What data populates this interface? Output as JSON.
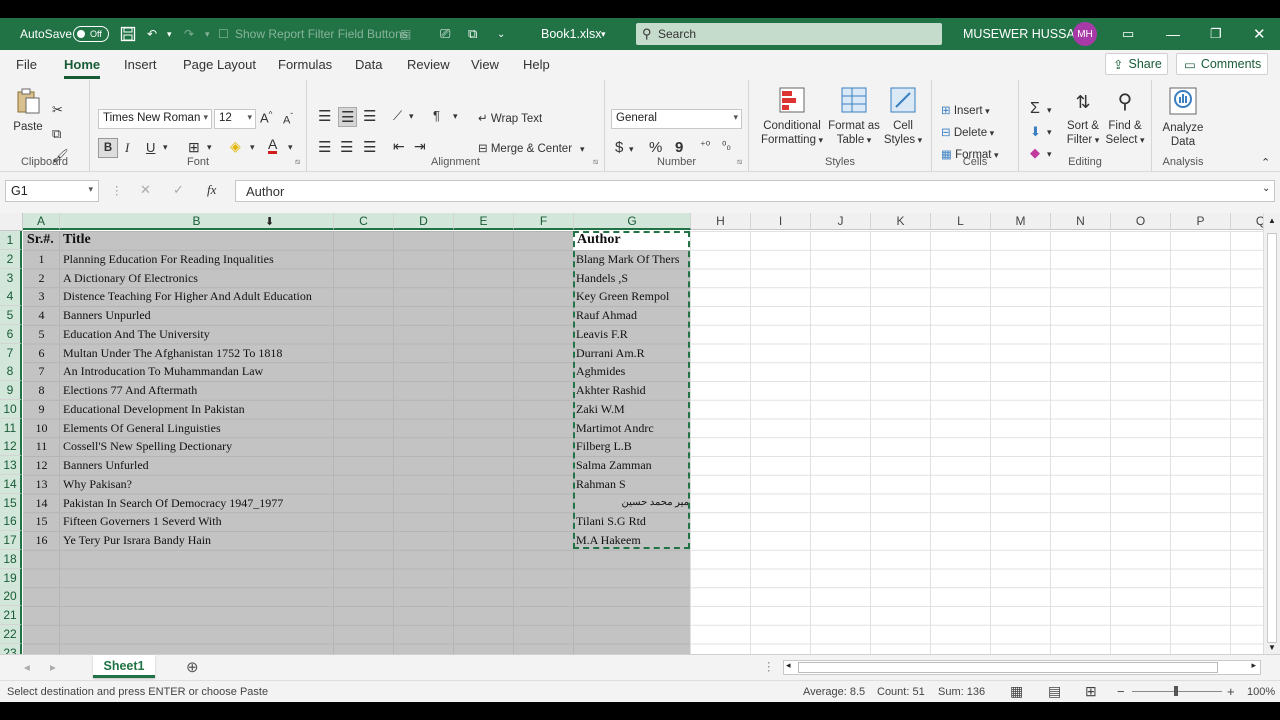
{
  "titlebar": {
    "autosave_label": "AutoSave",
    "autosave_state": "Off",
    "qat_dim_label": "Show Report Filter Field Buttons",
    "filename": "Book1.xlsx",
    "search_placeholder": "Search",
    "user_name": "MUSEWER HUSSAIN",
    "user_initials": "MH",
    "accent": "#217346"
  },
  "tabs": [
    "File",
    "Home",
    "Insert",
    "Page Layout",
    "Formulas",
    "Data",
    "Review",
    "View",
    "Help"
  ],
  "share_label": "Share",
  "comments_label": "Comments",
  "ribbon": {
    "clipboard": {
      "label": "Clipboard",
      "paste": "Paste"
    },
    "font": {
      "label": "Font",
      "family": "Times New Roman",
      "size": "12",
      "bold": "B",
      "italic": "I",
      "underline": "U"
    },
    "alignment": {
      "label": "Alignment",
      "wrap": "Wrap Text",
      "merge": "Merge & Center"
    },
    "number": {
      "label": "Number",
      "format": "General",
      "currency": "$",
      "percent": "%",
      "comma": "9"
    },
    "styles": {
      "label": "Styles",
      "cond1": "Conditional",
      "cond2": "Formatting",
      "table1": "Format as",
      "table2": "Table",
      "cell1": "Cell",
      "cell2": "Styles"
    },
    "cells": {
      "label": "Cells",
      "insert": "Insert",
      "delete": "Delete",
      "format": "Format"
    },
    "editing": {
      "label": "Editing",
      "sort1": "Sort &",
      "sort2": "Filter",
      "find1": "Find &",
      "find2": "Select"
    },
    "analysis": {
      "label": "Analysis",
      "analyze1": "Analyze",
      "analyze2": "Data"
    }
  },
  "formula_bar": {
    "name_box": "G1",
    "fx": "fx",
    "content": "Author"
  },
  "columns": [
    "A",
    "B",
    "C",
    "D",
    "E",
    "F",
    "G",
    "H",
    "I",
    "J",
    "K",
    "L",
    "M",
    "N",
    "O",
    "P",
    "Q"
  ],
  "rows": [
    "1",
    "2",
    "3",
    "4",
    "5",
    "6",
    "7",
    "8",
    "9",
    "10",
    "11",
    "12",
    "13",
    "14",
    "15",
    "16",
    "17",
    "18",
    "19",
    "20",
    "21",
    "22",
    "23"
  ],
  "header_row": {
    "sr": "Sr.#.",
    "title": "Title",
    "author": "Author"
  },
  "data_rows": [
    {
      "sr": "1",
      "title": "Planning Education For Reading Inqualities",
      "author": "Blang Mark  Of Thers"
    },
    {
      "sr": "2",
      "title": "A Dictionary Of Electronics",
      "author": "Handels ,S"
    },
    {
      "sr": "3",
      "title": "Distence Teaching For Higher And Adult Education",
      "author": "Key Green  Rempol"
    },
    {
      "sr": "4",
      "title": "Banners Unpurled",
      "author": "Rauf Ahmad"
    },
    {
      "sr": "5",
      "title": "Education And The University",
      "author": "Leavis  F.R"
    },
    {
      "sr": "6",
      "title": "Multan Under The Afghanistan 1752 To 1818",
      "author": "Durrani Am.R"
    },
    {
      "sr": "7",
      "title": "An Introducation To Muhammandan  Law",
      "author": "Aghmides"
    },
    {
      "sr": "8",
      "title": "Elections 77 And Aftermath",
      "author": "Akhter Rashid"
    },
    {
      "sr": "9",
      "title": "Educational Development In Pakistan",
      "author": "Zaki  W.M"
    },
    {
      "sr": "10",
      "title": "Elements Of General Linguisties",
      "author": "Martimot  Andrc"
    },
    {
      "sr": "11",
      "title": "Cossell'S  New Spelling Dectionary",
      "author": "Filberg  L.B"
    },
    {
      "sr": "12",
      "title": "Banners Unfurled",
      "author": "Salma Zamman"
    },
    {
      "sr": "13",
      "title": "Why Pakisan?",
      "author": "Rahman S"
    },
    {
      "sr": "14",
      "title": "Pakistan In Search Of Democracy  1947_1977",
      "author": "میر محمد حسین"
    },
    {
      "sr": "15",
      "title": "Fifteen  Governers  1 Severd With",
      "author": "Tilani  S.G Rtd"
    },
    {
      "sr": "16",
      "title": "Ye Tery Pur Israra Bandy Hain",
      "author": "M.A Hakeem"
    }
  ],
  "sheet_tab": "Sheet1",
  "status": {
    "message": "Select destination and press ENTER or choose Paste",
    "average": "Average: 8.5",
    "count": "Count: 51",
    "sum": "Sum: 136",
    "zoom": "100%"
  }
}
